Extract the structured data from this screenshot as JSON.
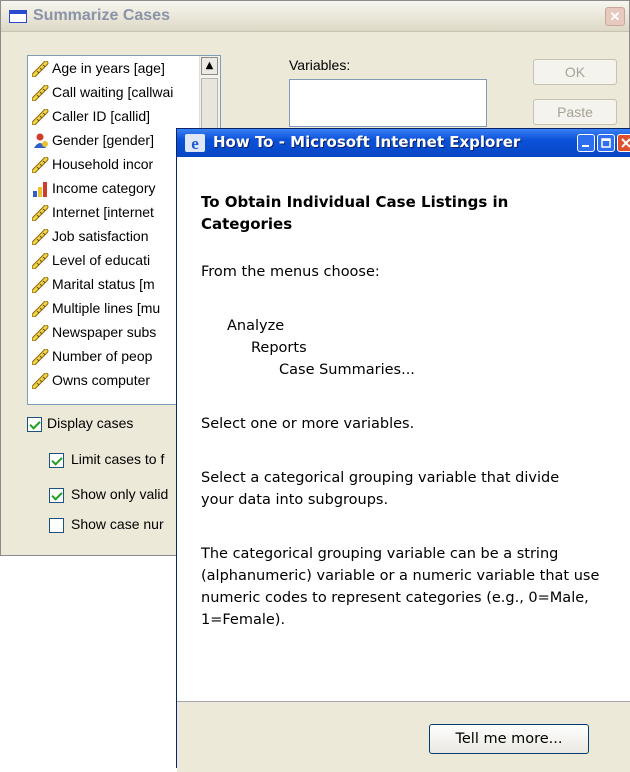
{
  "summarize": {
    "title": "Summarize Cases",
    "variables": [
      {
        "label": "Age in years [age]",
        "icon": "scale-ruler-icon"
      },
      {
        "label": "Call waiting [callwai",
        "icon": "scale-ruler-icon"
      },
      {
        "label": "Caller ID [callid]",
        "icon": "scale-ruler-icon"
      },
      {
        "label": "Gender [gender]",
        "icon": "nominal-person-icon"
      },
      {
        "label": "Household incor",
        "icon": "scale-ruler-icon"
      },
      {
        "label": "Income category",
        "icon": "ordinal-bars-icon"
      },
      {
        "label": "Internet [internet",
        "icon": "scale-ruler-icon"
      },
      {
        "label": "Job satisfaction",
        "icon": "scale-ruler-icon"
      },
      {
        "label": "Level of educati",
        "icon": "scale-ruler-icon"
      },
      {
        "label": "Marital status [m",
        "icon": "scale-ruler-icon"
      },
      {
        "label": "Multiple lines [mu",
        "icon": "scale-ruler-icon"
      },
      {
        "label": "Newspaper subs",
        "icon": "scale-ruler-icon"
      },
      {
        "label": "Number of peop",
        "icon": "scale-ruler-icon"
      },
      {
        "label": "Owns computer",
        "icon": "scale-ruler-icon"
      }
    ],
    "variables_label": "Variables:",
    "ok_label": "OK",
    "paste_label": "Paste",
    "display_cases": {
      "label": "Display cases",
      "checked": true
    },
    "limit_cases": {
      "label": "Limit cases to f",
      "checked": true
    },
    "show_valid": {
      "label": "Show only valid",
      "checked": true
    },
    "show_case_num": {
      "label": "Show case nur",
      "checked": false
    }
  },
  "ie": {
    "title": "How To - Microsoft Internet Explorer",
    "heading": "To Obtain Individual Case Listings in Categories",
    "menus_intro": "From the menus choose:",
    "menu_path": [
      "Analyze",
      "Reports",
      "Case Summaries..."
    ],
    "para1": "Select one or more variables.",
    "para2": "Select a categorical grouping variable that divide your data into subgroups.",
    "para3": "The categorical grouping variable can be a string (alphanumeric) variable or a numeric variable that use numeric codes to represent categories (e.g., 0=Male, 1=Female).",
    "tell_more_label": "Tell me more..."
  }
}
